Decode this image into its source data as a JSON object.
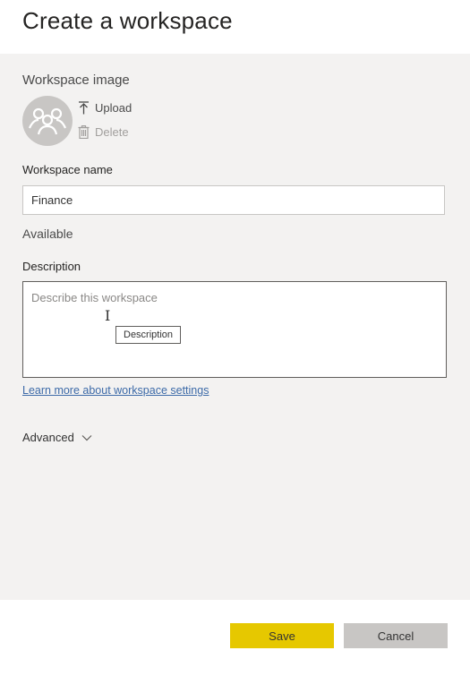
{
  "dialog": {
    "title": "Create a workspace"
  },
  "image": {
    "section_label": "Workspace image",
    "upload_label": "Upload",
    "delete_label": "Delete"
  },
  "name": {
    "label": "Workspace name",
    "value": "Finance",
    "status": "Available"
  },
  "description": {
    "label": "Description",
    "placeholder": "Describe this workspace",
    "tooltip": "Description"
  },
  "links": {
    "learn_more": "Learn more about workspace settings"
  },
  "advanced": {
    "label": "Advanced"
  },
  "buttons": {
    "save": "Save",
    "cancel": "Cancel"
  },
  "colors": {
    "save_bg": "#e6c800",
    "cancel_bg": "#c8c6c4",
    "link": "#3c6aa8",
    "panel_bg": "#f3f2f1"
  }
}
